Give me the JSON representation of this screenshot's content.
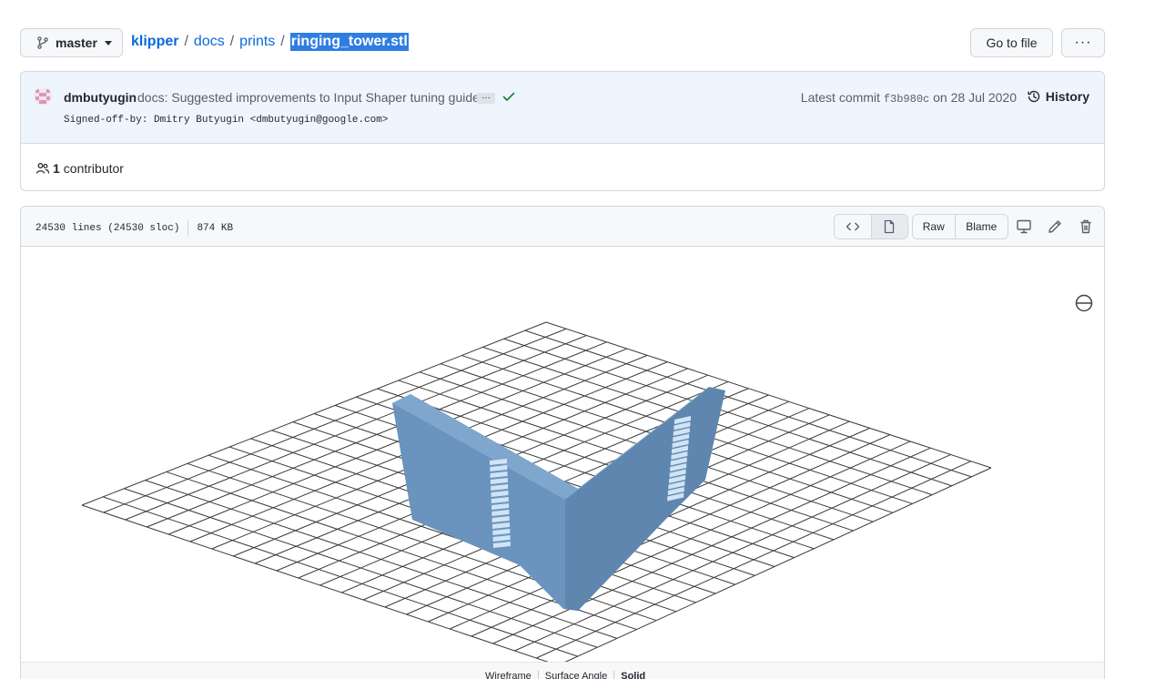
{
  "topbar": {
    "branch_label": "master",
    "breadcrumb": {
      "repo": "klipper",
      "folder1": "docs",
      "folder2": "prints",
      "file": "ringing_tower.stl",
      "separator": "/"
    },
    "goto_file_label": "Go to file",
    "more_label": "···"
  },
  "commit": {
    "author": "dmbutyugin",
    "message": "docs: Suggested improvements to Input Shaper tuning guide",
    "ellipsis": "…",
    "signed_off": "Signed-off-by: Dmitry Butyugin <dmbutyugin@google.com>",
    "latest_prefix": "Latest commit",
    "sha": "f3b980c",
    "date_text": "on 28 Jul 2020",
    "history_label": "History",
    "status_color": "#1a7f37"
  },
  "contributors": {
    "count": "1",
    "label": "contributor"
  },
  "file": {
    "lines": "24530 lines (24530 sloc)",
    "size": "874 KB",
    "raw_label": "Raw",
    "blame_label": "Blame"
  },
  "viewer": {
    "model_color": "#6a93bd",
    "modes": [
      "Wireframe",
      "Surface Angle",
      "Solid"
    ],
    "active_mode": "Solid"
  },
  "colors": {
    "link": "#0969da",
    "selection": "#2f7de1",
    "commit_bg": "#eef5fd"
  }
}
